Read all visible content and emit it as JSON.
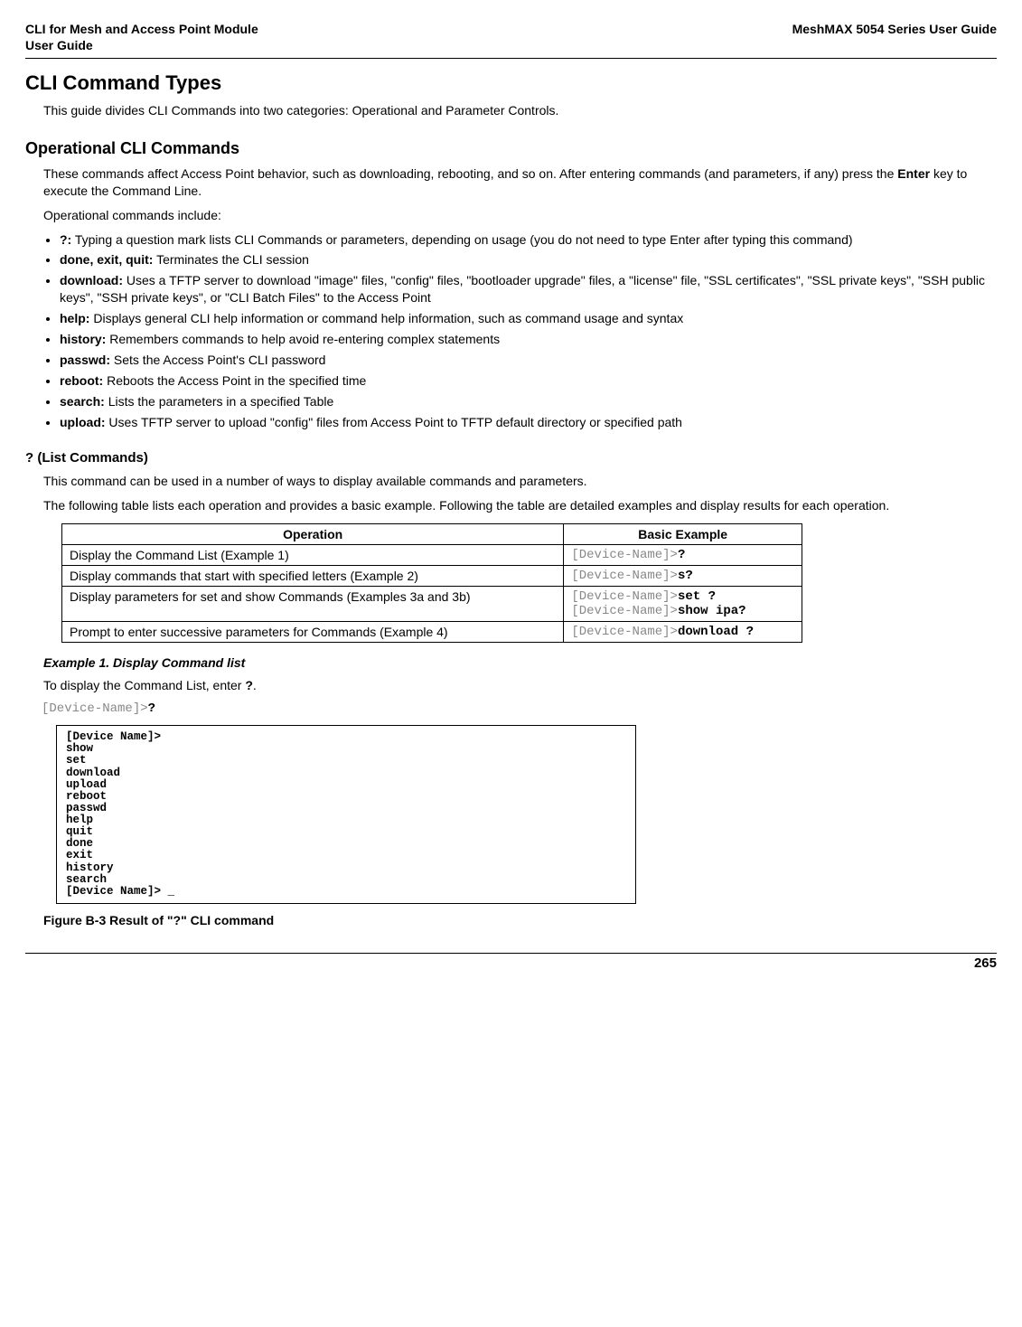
{
  "header": {
    "left_line1": "CLI for Mesh and Access Point Module",
    "left_line2": " User Guide",
    "right": "MeshMAX 5054 Series User Guide"
  },
  "h1": "CLI Command Types",
  "intro": "This guide divides CLI Commands into two categories: Operational and Parameter Controls.",
  "h2_operational": "Operational CLI Commands",
  "operational_p1a": "These commands affect Access Point behavior, such as downloading, rebooting, and so on. After entering commands (and parameters, if any) press the ",
  "operational_p1_bold": "Enter",
  "operational_p1b": " key to execute the Command Line.",
  "operational_p2": "Operational commands include:",
  "bullets": [
    {
      "b": "?:",
      "t": " Typing a question mark lists CLI Commands or parameters, depending on usage (you do not need to type Enter after typing this command)"
    },
    {
      "b": "done, exit, quit:",
      "t": " Terminates the CLI session"
    },
    {
      "b": "download:",
      "t": " Uses a TFTP server to download \"image\" files, \"config\" files, \"bootloader upgrade\" files, a \"license\" file, \"SSL certificates\", \"SSL private keys\", \"SSH public keys\", \"SSH private keys\", or \"CLI Batch Files\" to the Access Point"
    },
    {
      "b": "help:",
      "t": " Displays general CLI help information or command help information, such as command usage and syntax"
    },
    {
      "b": "history:",
      "t": " Remembers commands to help avoid re-entering complex statements"
    },
    {
      "b": "passwd:",
      "t": " Sets the Access Point's CLI password"
    },
    {
      "b": "reboot:",
      "t": " Reboots the Access Point in the specified time"
    },
    {
      "b": "search:",
      "t": " Lists the parameters in a specified Table"
    },
    {
      "b": "upload:",
      "t": " Uses TFTP server to upload \"config\" files from Access Point to TFTP default directory or specified path"
    }
  ],
  "h3_list": "? (List Commands)",
  "list_p1": "This command can be used in a number of ways to display available commands and parameters.",
  "list_p2": "The following table lists each operation and provides a basic example. Following the table are detailed examples and display results for each operation.",
  "table": {
    "headers": {
      "op": "Operation",
      "ex": "Basic Example"
    },
    "prompt": "[Device-Name]>",
    "rows": [
      {
        "op": "Display the Command List (Example 1)",
        "cmd": "?"
      },
      {
        "op": "Display commands that start with specified letters (Example 2)",
        "cmd": "s?"
      },
      {
        "op": "Display parameters for set and show Commands (Examples 3a and 3b)",
        "cmd1": "set ?",
        "cmd2": "show ipa?"
      },
      {
        "op": "Prompt to enter successive parameters for Commands (Example 4)",
        "cmd": "download ?"
      }
    ]
  },
  "example1_title": "Example 1. Display Command list",
  "example1_p_a": "To display the Command List, enter ",
  "example1_p_bold": "?",
  "example1_p_b": ".",
  "example1_cmd_prompt": "[Device-Name]>",
  "example1_cmd_bold": "?",
  "terminal": "[Device Name]>\nshow\nset\ndownload\nupload\nreboot\npasswd\nhelp\nquit\ndone\nexit\nhistory\nsearch\n[Device Name]> _",
  "figure_caption": "Figure B-3 Result of \"?\" CLI command",
  "page_number": "265"
}
